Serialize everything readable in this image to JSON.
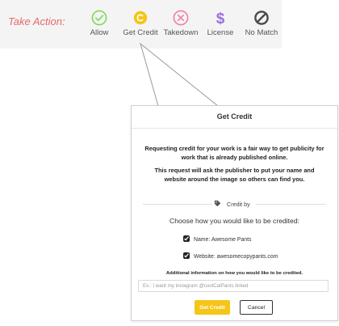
{
  "toolbar": {
    "title": "Take Action:",
    "actions": [
      {
        "label": "Allow",
        "icon": "check-circle-icon",
        "color": "#7ed957"
      },
      {
        "label": "Get Credit",
        "icon": "copyright-icon",
        "color": "#f5c518"
      },
      {
        "label": "Takedown",
        "icon": "x-circle-icon",
        "color": "#f27ea8"
      },
      {
        "label": "License",
        "icon": "dollar-icon",
        "color": "#9b6fe0"
      },
      {
        "label": "No Match",
        "icon": "no-match-icon",
        "color": "#4a4a4a"
      }
    ]
  },
  "dialog": {
    "title": "Get Credit",
    "intro_1": "Requesting credit for your work is a fair way to get publicity for work that is already published online.",
    "intro_2": "This request will ask the publisher to put your name and website around the image so others can find you.",
    "section_label": "Credit by",
    "choose_label": "Choose how you would like to be credited:",
    "options": [
      {
        "label": "Name: Awesome Pants",
        "checked": true
      },
      {
        "label": "Website: awesomecopypants.com",
        "checked": true
      }
    ],
    "additional_label": "Additional information on how you would like to be credited.",
    "input_placeholder": "Ex.: I want my instagram @coolCatPants linked",
    "input_value": "",
    "submit_label": "Get Credit",
    "cancel_label": "Cancel",
    "accent_color": "#f5c518"
  }
}
